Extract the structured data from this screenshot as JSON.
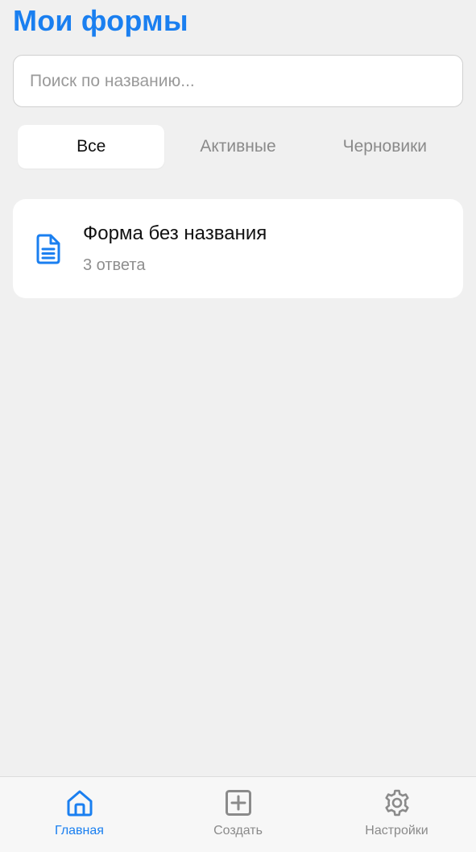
{
  "colors": {
    "accent": "#1a7ff0",
    "background": "#f0f0f0",
    "card": "#ffffff",
    "muted_text": "#8a8a8a"
  },
  "header": {
    "title": "Мои формы"
  },
  "search": {
    "value": "",
    "placeholder": "Поиск по названию..."
  },
  "tabs": [
    {
      "label": "Все",
      "active": true
    },
    {
      "label": "Активные",
      "active": false
    },
    {
      "label": "Черновики",
      "active": false
    }
  ],
  "forms": [
    {
      "icon": "document-icon",
      "title": "Форма без названия",
      "subtitle": "3 ответа"
    }
  ],
  "bottom_nav": [
    {
      "icon": "home-icon",
      "label": "Главная",
      "active": true
    },
    {
      "icon": "plus-square-icon",
      "label": "Создать",
      "active": false
    },
    {
      "icon": "gear-icon",
      "label": "Настройки",
      "active": false
    }
  ]
}
